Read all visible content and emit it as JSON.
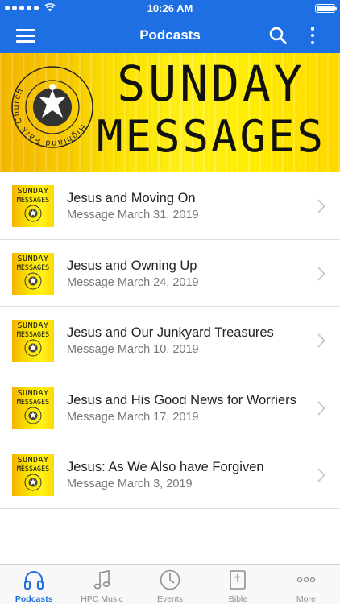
{
  "status_bar": {
    "time": "10:26 AM"
  },
  "nav": {
    "title": "Podcasts"
  },
  "banner": {
    "line1": "SUNDAY",
    "line2": "MESSAGES",
    "logo_text": "Highland Park Church"
  },
  "thumbnail": {
    "line1": "SUNDAY",
    "line2": "MESSAGES"
  },
  "episodes": [
    {
      "title": "Jesus and Moving On",
      "subtitle": "Message March 31, 2019"
    },
    {
      "title": "Jesus and Owning Up",
      "subtitle": "Message March 24, 2019"
    },
    {
      "title": "Jesus and Our Junkyard Treasures",
      "subtitle": "Message March 10, 2019"
    },
    {
      "title": "Jesus and His Good News for Worriers",
      "subtitle": "Message March 17, 2019"
    },
    {
      "title": "Jesus: As We Also have Forgiven",
      "subtitle": "Message March 3, 2019"
    }
  ],
  "tabs": [
    {
      "label": "Podcasts",
      "icon": "headphones-icon",
      "active": true
    },
    {
      "label": "HPC Music",
      "icon": "music-note-icon",
      "active": false
    },
    {
      "label": "Events",
      "icon": "clock-icon",
      "active": false
    },
    {
      "label": "Bible",
      "icon": "bible-icon",
      "active": false
    },
    {
      "label": "More",
      "icon": "more-dots-icon",
      "active": false
    }
  ],
  "colors": {
    "accent": "#1d6fe3",
    "banner_yellow": "#fbe300",
    "tab_inactive": "#8e8e93"
  }
}
